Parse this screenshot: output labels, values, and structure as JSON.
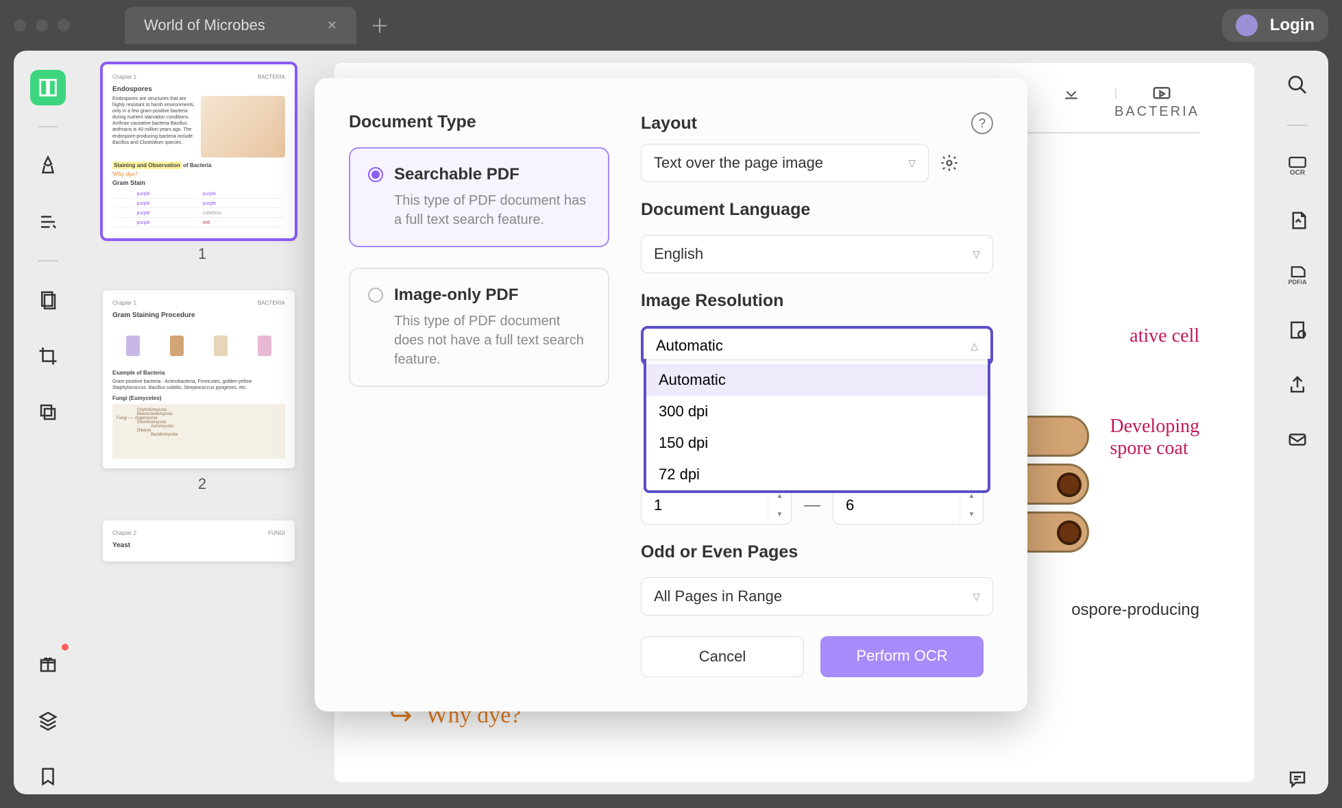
{
  "titlebar": {
    "tab_title": "World of Microbes",
    "login_label": "Login"
  },
  "thumbnails": {
    "page1": {
      "num": "1",
      "chapter": "Chapter 1",
      "tag": "BACTERIA",
      "heading": "Endospores",
      "body": "Endospores are structures that are highly resistant to harsh environments, only in a few gram-positive bacteria during nutrient starvation conditions. Anthrax-causative bacteria Bacillus anthracis is 40 million years ago. The endospore-producing bacteria include Bacillus and Clostridium species.",
      "highlight": "Staining and Observation",
      "highlight_suffix": " of Bacteria",
      "why": "Why dye?",
      "gram_title": "Gram Stain"
    },
    "page2": {
      "num": "2",
      "chapter": "Chapter 1",
      "tag": "BACTERIA",
      "heading": "Gram Staining Procedure",
      "sub": "Example of Bacteria",
      "fungi": "Fungi  (Eumycetes)"
    },
    "page3": {
      "chapter": "Chapter 2",
      "tag": "FUNGI",
      "heading": "Yeast"
    }
  },
  "document": {
    "header_right": "BACTERIA",
    "annot_cell": "ative cell",
    "annot_spore1": "Developing",
    "annot_spore2": "spore coat",
    "body_fragment": "ospore-producing",
    "section_highlight": "Staining and Observation of Bacteria",
    "why_dye": "Why dye?"
  },
  "modal": {
    "doc_type_label": "Document Type",
    "searchable": {
      "title": "Searchable PDF",
      "desc": "This type of PDF document has a full text search feature."
    },
    "image_only": {
      "title": "Image-only PDF",
      "desc": "This type of PDF document does not have a full text search feature."
    },
    "layout_label": "Layout",
    "layout_value": "Text over the page image",
    "lang_label": "Document Language",
    "lang_value": "English",
    "resolution_label": "Image Resolution",
    "resolution_value": "Automatic",
    "resolution_options": [
      "Automatic",
      "300 dpi",
      "150 dpi",
      "72 dpi"
    ],
    "page_from": "1",
    "page_to": "6",
    "odd_even_label": "Odd or Even Pages",
    "odd_even_value": "All Pages in Range",
    "cancel": "Cancel",
    "perform": "Perform OCR"
  },
  "right_rail": {
    "ocr": "OCR",
    "pdfa": "PDF/A"
  }
}
